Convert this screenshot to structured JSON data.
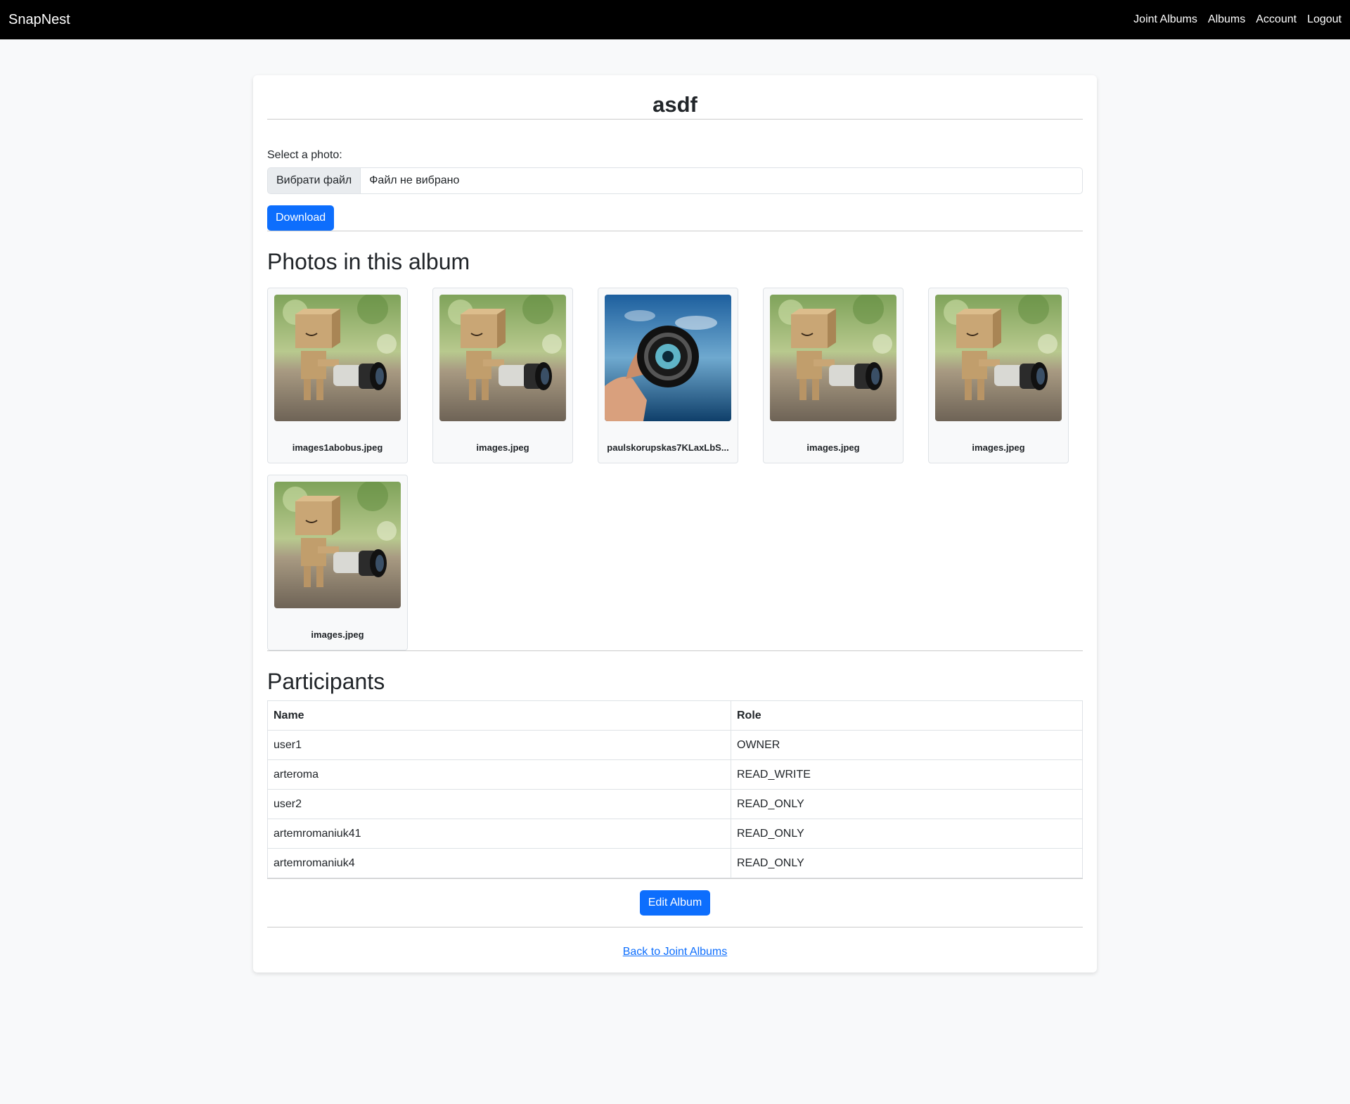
{
  "nav": {
    "brand": "SnapNest",
    "links": [
      "Joint Albums",
      "Albums",
      "Account",
      "Logout"
    ]
  },
  "album": {
    "title": "asdf"
  },
  "upload": {
    "label": "Select a photo:",
    "choose_button": "Вибрати файл",
    "no_file": "Файл не вибрано",
    "download_button": "Download"
  },
  "photos": {
    "heading": "Photos in this album",
    "items": [
      {
        "name": "images1abobus.jpeg",
        "kind": "box-robot"
      },
      {
        "name": "images.jpeg",
        "kind": "box-robot"
      },
      {
        "name": "paulskorupskas7KLaxLbS...",
        "kind": "lens"
      },
      {
        "name": "images.jpeg",
        "kind": "box-robot"
      },
      {
        "name": "images.jpeg",
        "kind": "box-robot"
      },
      {
        "name": "images.jpeg",
        "kind": "box-robot"
      }
    ]
  },
  "participants": {
    "heading": "Participants",
    "columns": [
      "Name",
      "Role"
    ],
    "rows": [
      [
        "user1",
        "OWNER"
      ],
      [
        "arteroma",
        "READ_WRITE"
      ],
      [
        "user2",
        "READ_ONLY"
      ],
      [
        "artemromaniuk41",
        "READ_ONLY"
      ],
      [
        "artemromaniuk4",
        "READ_ONLY"
      ]
    ]
  },
  "actions": {
    "edit_button": "Edit Album",
    "back_link": "Back to Joint Albums"
  }
}
